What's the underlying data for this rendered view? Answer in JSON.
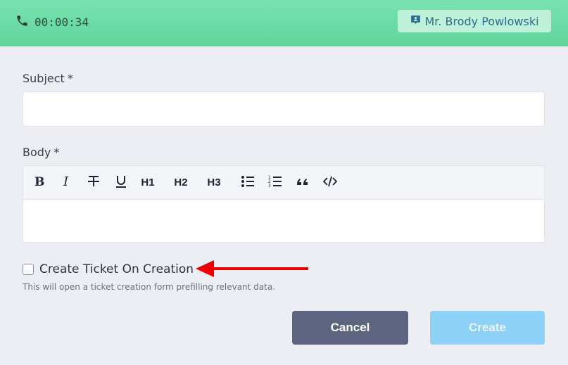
{
  "header": {
    "timer": "00:00:34",
    "contact_name": "Mr. Brody Powlowski",
    "colors": {
      "bar": "#5fd49b",
      "chip": "#bff0d9"
    }
  },
  "form": {
    "subject_label": "Subject",
    "subject_required": "*",
    "subject_value": "",
    "body_label": "Body",
    "body_required": "*",
    "toolbar": {
      "h1": "H1",
      "h2": "H2",
      "h3": "H3",
      "icons": [
        "bold-icon",
        "italic-icon",
        "strikethrough-icon",
        "underline-icon",
        "bulleted-list-icon",
        "numbered-list-icon",
        "quote-icon",
        "code-icon"
      ]
    },
    "checkbox_label": "Create Ticket On Creation",
    "checkbox_checked": false,
    "hint": "This will open a ticket creation form prefilling relevant data."
  },
  "actions": {
    "cancel_label": "Cancel",
    "create_label": "Create",
    "create_disabled": true
  },
  "annotation": {
    "arrow_color": "#ee0000"
  }
}
